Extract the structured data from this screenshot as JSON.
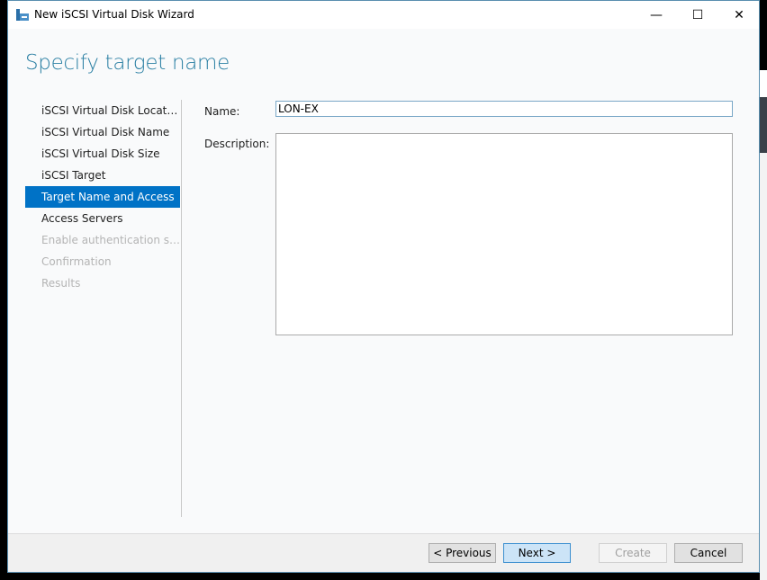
{
  "window": {
    "title": "New iSCSI Virtual Disk Wizard",
    "minimize": "—",
    "maximize": "☐",
    "close": "✕"
  },
  "page_title": "Specify target name",
  "nav": {
    "items": [
      {
        "label": "iSCSI Virtual Disk Location",
        "state": "normal"
      },
      {
        "label": "iSCSI Virtual Disk Name",
        "state": "normal"
      },
      {
        "label": "iSCSI Virtual Disk Size",
        "state": "normal"
      },
      {
        "label": "iSCSI Target",
        "state": "normal"
      },
      {
        "label": "Target Name and Access",
        "state": "active"
      },
      {
        "label": "Access Servers",
        "state": "normal"
      },
      {
        "label": "Enable authentication ser...",
        "state": "disabled"
      },
      {
        "label": "Confirmation",
        "state": "disabled"
      },
      {
        "label": "Results",
        "state": "disabled"
      }
    ]
  },
  "form": {
    "name_label": "Name:",
    "name_value": "LON-EX",
    "description_label": "Description:",
    "description_value": ""
  },
  "footer": {
    "previous": "< Previous",
    "next": "Next >",
    "create": "Create",
    "cancel": "Cancel"
  },
  "colors": {
    "accent": "#0072c6",
    "heading": "#2a7fa3"
  }
}
